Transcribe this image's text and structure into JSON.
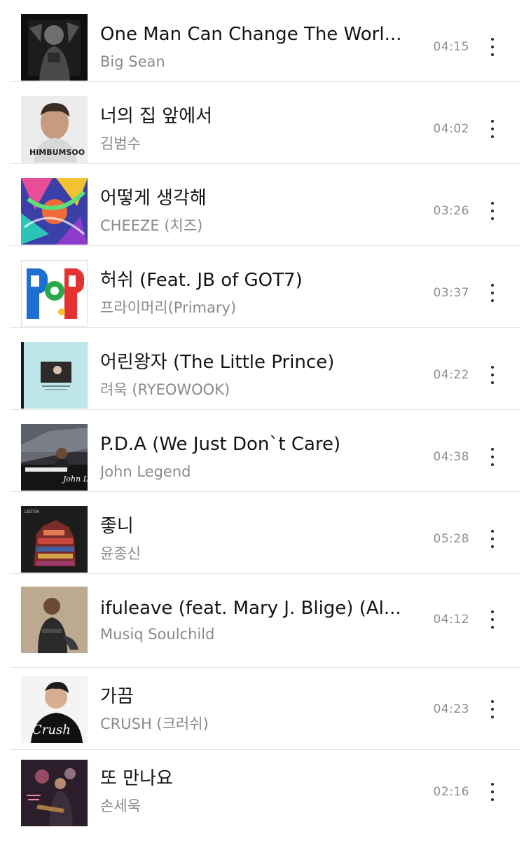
{
  "tracks": [
    {
      "title": "One Man Can Change The Worl...",
      "artist": "Big Sean",
      "duration": "04:15",
      "art": "album-art-big-sean"
    },
    {
      "title": "너의 집 앞에서",
      "artist": "김범수",
      "duration": "04:02",
      "art": "album-art-kim-bum-soo",
      "art_text": "HIMBUMSOO"
    },
    {
      "title": "어떻게 생각해",
      "artist": "CHEEZE (치즈)",
      "duration": "03:26",
      "art": "album-art-cheeze"
    },
    {
      "title": "허쉬 (Feat. JB of GOT7)",
      "artist": "프라이머리(Primary)",
      "duration": "03:37",
      "art": "album-art-primary",
      "art_text": "POP"
    },
    {
      "title": "어린왕자 (The Little Prince)",
      "artist": "려욱 (RYEOWOOK)",
      "duration": "04:22",
      "art": "album-art-ryeowook"
    },
    {
      "title": "P.D.A (We Just Don`t Care)",
      "artist": "John Legend",
      "duration": "04:38",
      "art": "album-art-john-legend",
      "art_text": "John Legend"
    },
    {
      "title": "좋니",
      "artist": "윤종신",
      "duration": "05:28",
      "art": "album-art-yoon-jong-shin",
      "art_text": "LISTEN"
    },
    {
      "title": "ifuleave (feat. Mary J. Blige) (Al...",
      "artist": "Musiq Soulchild",
      "duration": "04:12",
      "art": "album-art-musiq-soulchild"
    },
    {
      "title": "가끔",
      "artist": "CRUSH (크러쉬)",
      "duration": "04:23",
      "art": "album-art-crush",
      "art_text": "Crush"
    },
    {
      "title": "또 만나요",
      "artist": "손세욱",
      "duration": "02:16",
      "art": "album-art-son-se-wook"
    }
  ],
  "colors": {
    "title": "#141414",
    "artist": "#8a8a8a",
    "duration": "#8e8e8e",
    "separator": "#e3e3e3",
    "more_dots": "#2a2a2a"
  },
  "icons": {
    "more": "vertical-ellipsis-icon"
  }
}
